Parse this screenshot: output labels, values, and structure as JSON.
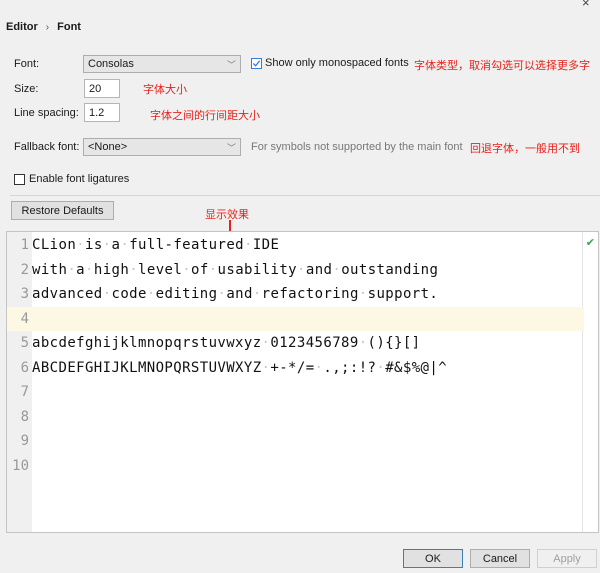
{
  "breadcrumb": {
    "parent": "Editor",
    "separator": "›",
    "current": "Font"
  },
  "window": {
    "close_icon": "close-x-icon"
  },
  "font": {
    "label": "Font:",
    "value": "Consolas",
    "annotation": "字体类型，取消勾选可以选择更多字"
  },
  "monospaced": {
    "label": "Show only monospaced fonts",
    "checked": true
  },
  "size": {
    "label": "Size:",
    "value": "20",
    "annotation": "字体大小"
  },
  "line_spacing": {
    "label": "Line spacing:",
    "value": "1.2",
    "annotation": "字体之间的行间距大小"
  },
  "fallback": {
    "label": "Fallback font:",
    "value": "<None>",
    "hint": "For symbols not supported by the main font",
    "annotation": "回退字体，一般用不到"
  },
  "ligatures": {
    "label": "Enable font ligatures",
    "checked": false
  },
  "restore_defaults": "Restore Defaults",
  "preview_annotation": "显示效果",
  "preview": {
    "lines": [
      {
        "num": "1",
        "text": "CLion·is·a·full-featured·IDE"
      },
      {
        "num": "2",
        "text": "with·a·high·level·of·usability·and·outstanding"
      },
      {
        "num": "3",
        "text": "advanced·code·editing·and·refactoring·support."
      },
      {
        "num": "4",
        "text": ""
      },
      {
        "num": "5",
        "text": "abcdefghijklmnopqrstuvwxyz·0123456789·(){}[]"
      },
      {
        "num": "6",
        "text": "ABCDEFGHIJKLMNOPQRSTUVWXYZ·+-*/=·.,;:!?·#&$%@|^"
      },
      {
        "num": "7",
        "text": ""
      },
      {
        "num": "8",
        "text": ""
      },
      {
        "num": "9",
        "text": ""
      },
      {
        "num": "10",
        "text": ""
      }
    ],
    "current_line": "4",
    "status_icon": "check-icon"
  },
  "buttons": {
    "ok": "OK",
    "cancel": "Cancel",
    "apply": "Apply"
  },
  "colors": {
    "annotation": "#e8211a",
    "checkbox_accent": "#3a7bd5",
    "current_line_bg": "#fdf8e3",
    "ok_status": "#3aa34a"
  }
}
